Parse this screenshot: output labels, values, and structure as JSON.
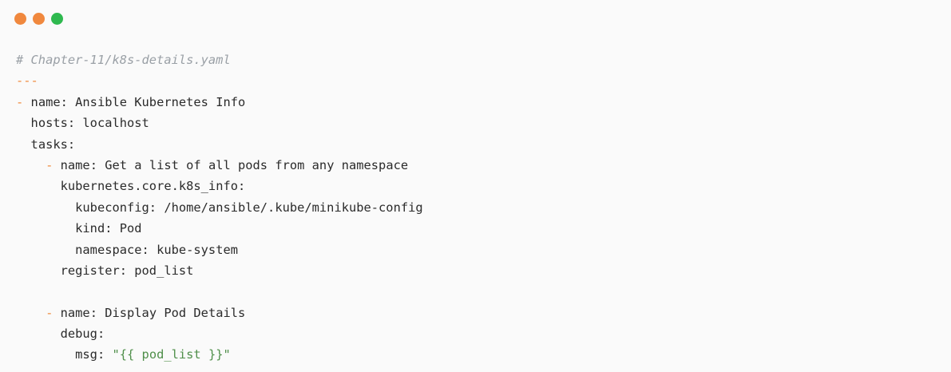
{
  "window": {
    "controls": [
      {
        "name": "close",
        "color": "#f0883e"
      },
      {
        "name": "minimize",
        "color": "#f0883e"
      },
      {
        "name": "maximize",
        "color": "#2fb94f"
      }
    ]
  },
  "code": {
    "lines": [
      {
        "indent": "",
        "dash": "",
        "text": "",
        "comment": "# Chapter-11/k8s-details.yaml",
        "str": ""
      },
      {
        "indent": "",
        "dash": "---",
        "text": "",
        "comment": "",
        "str": ""
      },
      {
        "indent": "",
        "dash": "- ",
        "text": "name: Ansible Kubernetes Info",
        "comment": "",
        "str": ""
      },
      {
        "indent": "  ",
        "dash": "",
        "text": "hosts: localhost",
        "comment": "",
        "str": ""
      },
      {
        "indent": "  ",
        "dash": "",
        "text": "tasks:",
        "comment": "",
        "str": ""
      },
      {
        "indent": "    ",
        "dash": "- ",
        "text": "name: Get a list of all pods from any namespace",
        "comment": "",
        "str": ""
      },
      {
        "indent": "      ",
        "dash": "",
        "text": "kubernetes.core.k8s_info:",
        "comment": "",
        "str": ""
      },
      {
        "indent": "        ",
        "dash": "",
        "text": "kubeconfig: /home/ansible/.kube/minikube-config",
        "comment": "",
        "str": ""
      },
      {
        "indent": "        ",
        "dash": "",
        "text": "kind: Pod",
        "comment": "",
        "str": ""
      },
      {
        "indent": "        ",
        "dash": "",
        "text": "namespace: kube-system",
        "comment": "",
        "str": ""
      },
      {
        "indent": "      ",
        "dash": "",
        "text": "register: pod_list",
        "comment": "",
        "str": ""
      },
      {
        "indent": "",
        "dash": "",
        "text": "",
        "comment": "",
        "str": ""
      },
      {
        "indent": "    ",
        "dash": "- ",
        "text": "name: Display Pod Details",
        "comment": "",
        "str": ""
      },
      {
        "indent": "      ",
        "dash": "",
        "text": "debug:",
        "comment": "",
        "str": ""
      },
      {
        "indent": "        ",
        "dash": "",
        "text": "msg: ",
        "comment": "",
        "str": "\"{{ pod_list }}\""
      }
    ]
  }
}
